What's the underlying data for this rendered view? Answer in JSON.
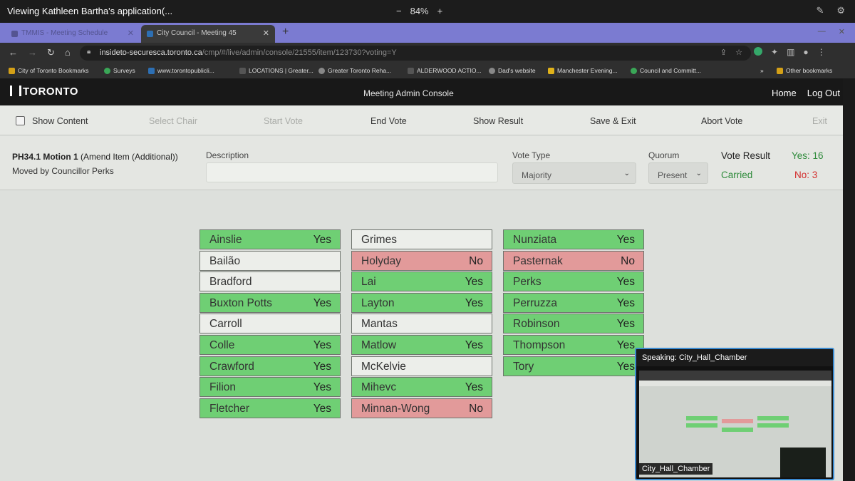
{
  "share": {
    "title": "Viewing Kathleen Bartha's application(...",
    "zoom": "84%",
    "zoom_minus": "−",
    "zoom_plus": "+"
  },
  "browser": {
    "tabs": [
      {
        "label": "TMMIS - Meeting Schedule"
      },
      {
        "label": "City Council - Meeting 45"
      }
    ],
    "url_host": "insideto-securesca.toronto.ca",
    "url_path": "/cmp/#/live/admin/console/21555/item/123730?voting=Y",
    "bookmarks": [
      "City of Toronto Bookmarks",
      "Surveys",
      "www.torontopublicli...",
      "LOCATIONS | Greater...",
      "Greater Toronto Reha...",
      "ALDERWOOD ACTIO...",
      "Dad's website",
      "Manchester Evening...",
      "Council and Committ...",
      "Other bookmarks"
    ]
  },
  "app": {
    "logo": "TORONTO",
    "title": "Meeting Admin Console",
    "nav": {
      "home": "Home",
      "logout": "Log Out"
    }
  },
  "toolbar": {
    "show_content": "Show Content",
    "select_chair": "Select Chair",
    "start_vote": "Start Vote",
    "end_vote": "End Vote",
    "show_result": "Show Result",
    "save_exit": "Save & Exit",
    "abort_vote": "Abort Vote",
    "exit": "Exit"
  },
  "motion": {
    "id": "PH34.1 Motion 1",
    "type": "(Amend Item (Additional))",
    "moved_by": "Moved by Councillor Perks",
    "description_label": "Description",
    "description_value": "",
    "vote_type_label": "Vote Type",
    "vote_type_value": "Majority",
    "quorum_label": "Quorum",
    "quorum_value": "Present",
    "result_label": "Vote Result",
    "result_status": "Carried",
    "yes_text": "Yes: 16",
    "no_text": "No: 3"
  },
  "votes": {
    "col1": [
      {
        "name": "Ainslie",
        "vote": "Yes"
      },
      {
        "name": "Bailão",
        "vote": ""
      },
      {
        "name": "Bradford",
        "vote": ""
      },
      {
        "name": "Buxton Potts",
        "vote": "Yes"
      },
      {
        "name": "Carroll",
        "vote": ""
      },
      {
        "name": "Colle",
        "vote": "Yes"
      },
      {
        "name": "Crawford",
        "vote": "Yes"
      },
      {
        "name": "Filion",
        "vote": "Yes"
      },
      {
        "name": "Fletcher",
        "vote": "Yes"
      }
    ],
    "col2": [
      {
        "name": "Grimes",
        "vote": ""
      },
      {
        "name": "Holyday",
        "vote": "No"
      },
      {
        "name": "Lai",
        "vote": "Yes"
      },
      {
        "name": "Layton",
        "vote": "Yes"
      },
      {
        "name": "Mantas",
        "vote": ""
      },
      {
        "name": "Matlow",
        "vote": "Yes"
      },
      {
        "name": "McKelvie",
        "vote": ""
      },
      {
        "name": "Mihevc",
        "vote": "Yes"
      },
      {
        "name": "Minnan-Wong",
        "vote": "No"
      }
    ],
    "col3": [
      {
        "name": "Nunziata",
        "vote": "Yes"
      },
      {
        "name": "Pasternak",
        "vote": "No"
      },
      {
        "name": "Perks",
        "vote": "Yes"
      },
      {
        "name": "Perruzza",
        "vote": "Yes"
      },
      {
        "name": "Robinson",
        "vote": "Yes"
      },
      {
        "name": "Thompson",
        "vote": "Yes"
      },
      {
        "name": "Tory",
        "vote": "Yes"
      }
    ]
  },
  "speaker": {
    "label": "Speaking: City_Hall_Chamber",
    "tag": "City_Hall_Chamber"
  },
  "colors": {
    "yes": "#6fcf74",
    "no": "#e29a9a",
    "none": "#eceeea",
    "carried": "#2d8a3a",
    "no_text": "#d32c2c"
  }
}
